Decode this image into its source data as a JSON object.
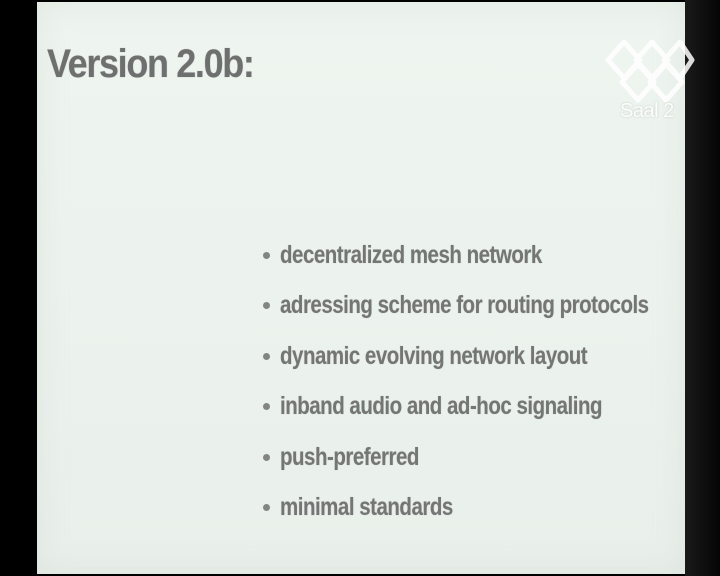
{
  "slide": {
    "title": "Version 2.0b:",
    "bullets": [
      "decentralized mesh network",
      "adressing scheme for routing protocols",
      "dynamic evolving network layout",
      "inband audio and ad-hoc signaling",
      "push-preferred",
      "minimal standards"
    ]
  },
  "overlay": {
    "logo_icon": "conference-logo-icon",
    "logo_text": "Saal 2"
  },
  "colors": {
    "slide_background": "#ecf2ed",
    "text": "#747675",
    "frame": "#000000"
  }
}
